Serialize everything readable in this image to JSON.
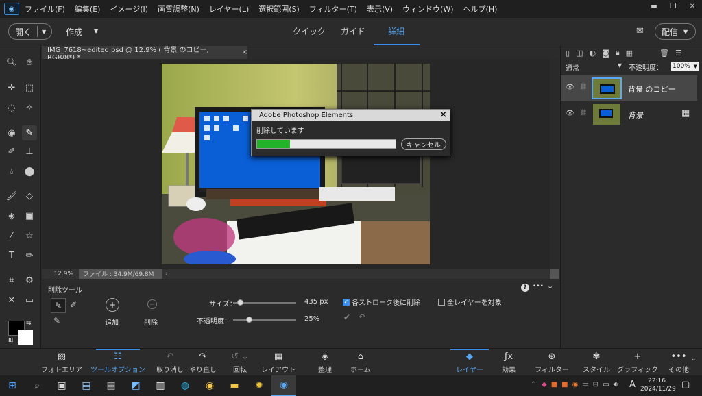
{
  "menu": {
    "items": [
      "ファイル(F)",
      "編集(E)",
      "イメージ(I)",
      "画質調整(N)",
      "レイヤー(L)",
      "選択範囲(S)",
      "フィルター(T)",
      "表示(V)",
      "ウィンドウ(W)",
      "ヘルプ(H)"
    ]
  },
  "window_controls": {
    "minimize": "▬",
    "restore": "❐",
    "close": "✕"
  },
  "header": {
    "open_label": "開く",
    "create_label": "作成",
    "modes": {
      "quick": "クイック",
      "guided": "ガイド",
      "expert": "詳細"
    },
    "share_label": "配信"
  },
  "document": {
    "tab_title": "IMG_7618~edited.psd @ 12.9% ( 背景 のコピー, RGB/8*) *",
    "close": "×",
    "zoom": "12.9%",
    "file_info": "ファイル : 34.9M/69.8M",
    "nav_arrow": "›"
  },
  "dialog": {
    "title": "Adobe Photoshop Elements",
    "message": "削除しています",
    "progress": 0.24,
    "cancel_label": "キャンセル",
    "close": "×"
  },
  "layers": {
    "blend_mode": "通常",
    "opacity_label": "不透明度：",
    "opacity_value": "100%",
    "items": [
      {
        "name": "背景 のコピー",
        "selected": true
      },
      {
        "name": "背景",
        "selected": false
      }
    ]
  },
  "tool_options": {
    "tool_name": "削除ツール",
    "add_label": "追加",
    "remove_label": "削除",
    "size_label": "サイズ：",
    "size_value": "435 px",
    "size_level": 0.11,
    "opacity_label": "不透明度：",
    "opacity_value": "25%",
    "opacity_level": 0.25,
    "stroke_option_label": "各ストローク後に削除",
    "stroke_option_checked": true,
    "all_layers_label": "全レイヤーを対象",
    "all_layers_checked": false,
    "help": "?",
    "more": "•••",
    "collapse": "⌄"
  },
  "bottom": {
    "photo_bin": "フォトエリア",
    "tool_options": "ツールオプション",
    "undo": "取り消し",
    "redo": "やり直し",
    "rotate": "回転",
    "layout": "レイアウト",
    "organizer": "整理",
    "home": "ホーム",
    "layers": "レイヤー",
    "effects": "効果",
    "filters": "フィルター",
    "styles": "スタイル",
    "graphics": "グラフィック",
    "more": "その他"
  },
  "taskbar": {
    "time": "22:16",
    "date": "2024/11/29",
    "ime": "A"
  },
  "colors": {
    "accent": "#3d8ee8",
    "progress": "#22b32a",
    "bg": "#2b2b2b"
  }
}
